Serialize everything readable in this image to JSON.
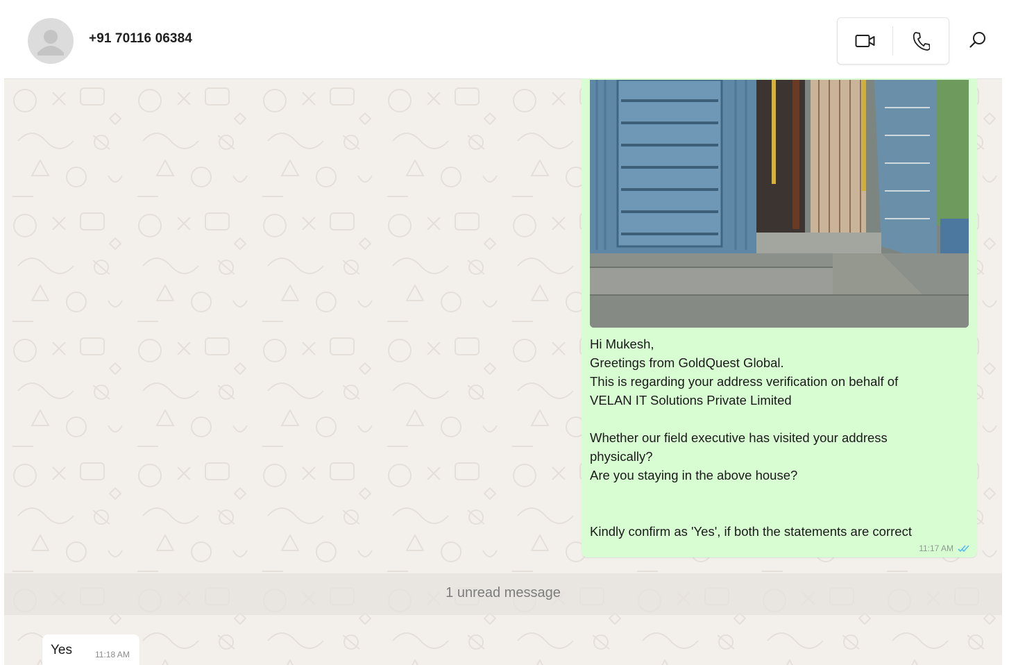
{
  "header": {
    "contact_name": "+91 70116 06384",
    "avatar_icon": "default-person-icon",
    "video_call_icon": "video-camera-icon",
    "voice_call_icon": "phone-icon",
    "search_icon": "search-icon"
  },
  "messages": {
    "outgoing": {
      "has_photo": true,
      "lines": [
        "Hi Mukesh,",
        "Greetings from GoldQuest Global.",
        "This is regarding your address verification on behalf of",
        "VELAN IT Solutions Private Limited",
        "",
        "Whether our field executive has visited your address",
        "physically?",
        "Are you staying in the above house?",
        "",
        "",
        "Kindly confirm as 'Yes', if both the statements are correct"
      ],
      "time": "11:17 AM",
      "status_icon": "double-check-icon"
    },
    "unread_divider": "1 unread message",
    "incoming": {
      "text": "Yes",
      "time": "11:18 AM"
    }
  },
  "colors": {
    "outgoing_bubble": "#d9fdd3",
    "incoming_bubble": "#ffffff",
    "chat_background": "#f3efea",
    "read_tick": "#53bdeb"
  }
}
